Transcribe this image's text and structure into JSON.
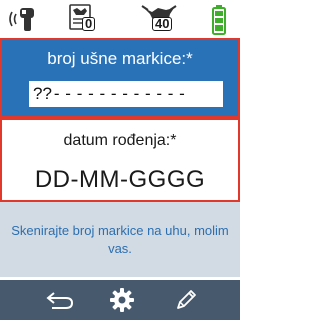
{
  "status": {
    "icons": [
      "rfid-scanner-icon",
      "herd-list-icon",
      "cattle-count-icon",
      "battery-icon"
    ],
    "herd_count": "0",
    "cattle_count": "40",
    "battery_color": "#3fae2a"
  },
  "eartag": {
    "label": "broj ušne markice:*",
    "prefix": "??",
    "placeholder_dashes": "- - - - - - - - - - - -"
  },
  "birthdate": {
    "label": "datum rođenja:*",
    "value": "DD-MM-GGGG"
  },
  "message": "Skenirajte broj markice na uhu, molim vas.",
  "toolbar": {
    "icons": [
      "back-icon",
      "settings-gear-icon",
      "edit-pencil-icon"
    ]
  },
  "colors": {
    "header_blue": "#2a72b8",
    "active_border": "#e2382b",
    "message_bg": "#d2dae3",
    "message_text": "#2c6fb0",
    "toolbar_bg": "#46596d"
  }
}
